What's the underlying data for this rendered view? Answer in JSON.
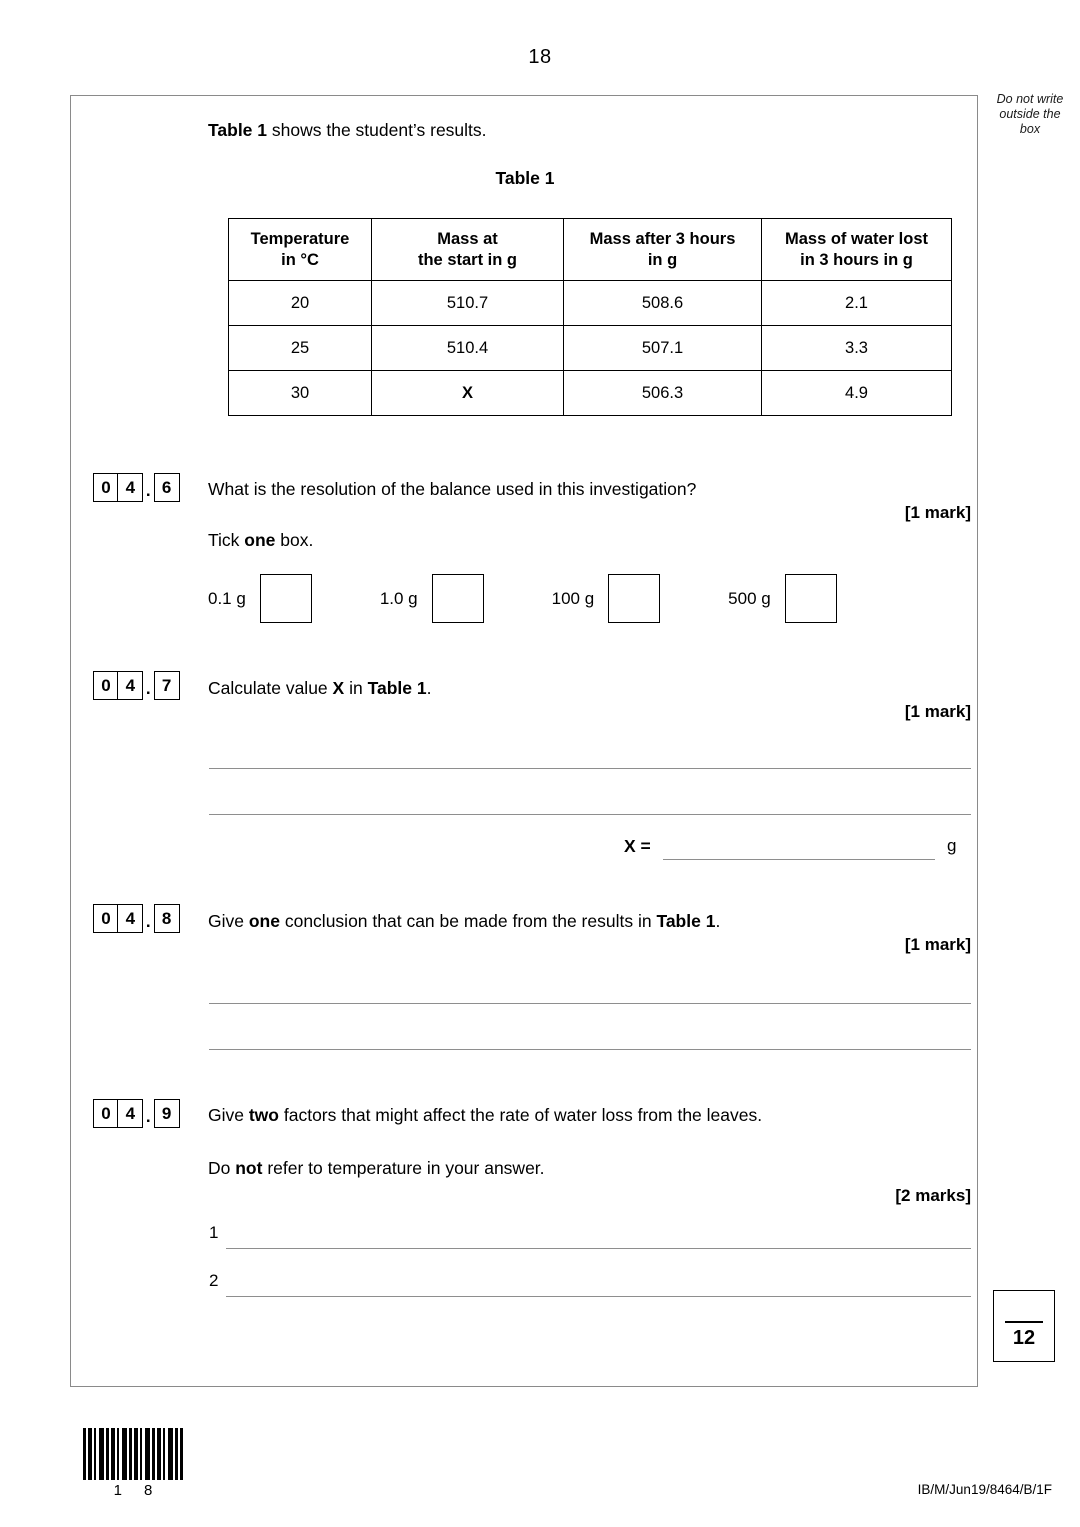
{
  "page": {
    "number": "18",
    "do_not_write_notice": "Do not write\noutside the\nbox",
    "do_not_write_line1": "Do not write",
    "do_not_write_line2": "outside the",
    "do_not_write_line3": "box",
    "reference_code": "IB/M/Jun19/8464/B/1F"
  },
  "intro": {
    "bold_prefix": "Table 1",
    "rest": " shows the student’s results."
  },
  "table": {
    "caption": "Table 1",
    "headers": [
      "Temperature\nin °C",
      "Mass at\nthe start in g",
      "Mass after 3 hours\nin g",
      "Mass of water lost\nin 3 hours in g"
    ],
    "header_lines": [
      [
        "Temperature",
        "in °C"
      ],
      [
        "Mass at",
        "the start in g"
      ],
      [
        "Mass after 3 hours",
        "in g"
      ],
      [
        "Mass of water lost",
        "in 3 hours in g"
      ]
    ],
    "rows": [
      [
        "20",
        "510.7",
        "508.6",
        "2.1"
      ],
      [
        "25",
        "510.4",
        "507.1",
        "3.3"
      ],
      [
        "30",
        "X",
        "506.3",
        "4.9"
      ]
    ]
  },
  "questions": [
    {
      "id": "04.6",
      "digits": [
        "0",
        "4"
      ],
      "sub": "6",
      "prompt": "What is the resolution of the balance used in this investigation?",
      "marks": "[1 mark]",
      "instruction_prefix": "Tick ",
      "instruction_bold": "one",
      "instruction_suffix": " box.",
      "options": [
        "0.1 g",
        "1.0 g",
        "100 g",
        "500 g"
      ]
    },
    {
      "id": "04.7",
      "digits": [
        "0",
        "4"
      ],
      "sub": "7",
      "prompt_part1": "Calculate value ",
      "prompt_bold1": "X",
      "prompt_part2": " in ",
      "prompt_bold2": "Table 1",
      "prompt_part3": ".",
      "marks": "[1 mark]",
      "answer_label": "X =",
      "answer_unit": "g"
    },
    {
      "id": "04.8",
      "digits": [
        "0",
        "4"
      ],
      "sub": "8",
      "prompt_part1": "Give ",
      "prompt_bold1": "one",
      "prompt_part2": " conclusion that can be made from the results in ",
      "prompt_bold2": "Table 1",
      "prompt_part3": ".",
      "marks": "[1 mark]"
    },
    {
      "id": "04.9",
      "digits": [
        "0",
        "4"
      ],
      "sub": "9",
      "prompt_part1": "Give ",
      "prompt_bold1": "two",
      "prompt_part2": " factors that might affect the rate of water loss from the leaves.",
      "note_part1": "Do ",
      "note_bold": "not",
      "note_part2": " refer to temperature in your answer.",
      "marks": "[2 marks]",
      "line_numbers": [
        "1",
        "2"
      ]
    }
  ],
  "total_marks_box": {
    "value": "12"
  },
  "barcode": {
    "digit_left": "1",
    "digit_right": "8"
  }
}
